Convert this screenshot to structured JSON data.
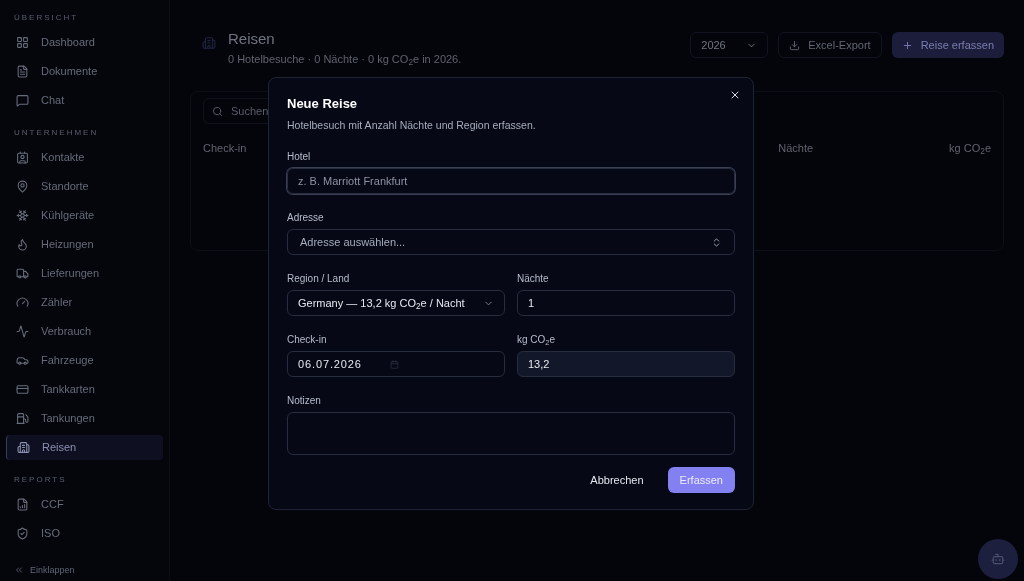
{
  "sidebar": {
    "sections": [
      {
        "title": "ÜBERSICHT",
        "items": [
          {
            "label": "Dashboard",
            "selected": false
          },
          {
            "label": "Dokumente",
            "selected": false
          },
          {
            "label": "Chat",
            "selected": false
          }
        ]
      },
      {
        "title": "UNTERNEHMEN",
        "items": [
          {
            "label": "Kontakte",
            "selected": false
          },
          {
            "label": "Standorte",
            "selected": false
          },
          {
            "label": "Kühlgeräte",
            "selected": false
          },
          {
            "label": "Heizungen",
            "selected": false
          },
          {
            "label": "Lieferungen",
            "selected": false
          },
          {
            "label": "Zähler",
            "selected": false
          },
          {
            "label": "Verbrauch",
            "selected": false
          },
          {
            "label": "Fahrzeuge",
            "selected": false
          },
          {
            "label": "Tankkarten",
            "selected": false
          },
          {
            "label": "Tankungen",
            "selected": false
          },
          {
            "label": "Reisen",
            "selected": true
          }
        ]
      },
      {
        "title": "REPORTS",
        "items": [
          {
            "label": "CCF",
            "selected": false
          },
          {
            "label": "ISO",
            "selected": false
          }
        ]
      }
    ],
    "collapse": "Einklappen"
  },
  "page": {
    "title": "Reisen",
    "subtitle": "0 Hotelbesuche · 0 Nächte · 0 kg CO$_{2}$e in 2026.",
    "year": "2026",
    "export": "Excel-Export",
    "add": "Reise erfassen",
    "search": {
      "placeholder": "Suchen"
    },
    "table": {
      "columns": [
        "Check-in",
        "Nächte",
        "kg CO$_{2}$e"
      ]
    }
  },
  "dialog": {
    "title": "Neue Reise",
    "description": "Hotelbesuch mit Anzahl Nächte und Region erfassen.",
    "hotel": {
      "label": "Hotel",
      "placeholder": "z. B. Marriott Frankfurt",
      "focused": true
    },
    "address": {
      "label": "Adresse",
      "placeholder": "Adresse auswählen..."
    },
    "region": {
      "label": "Region / Land",
      "value": "Germany — 13,2 kg CO$_{2}$e / Nacht"
    },
    "nights": {
      "label": "Nächte",
      "value": "1"
    },
    "checkin": {
      "label": "Check-in",
      "value": "06.07.2026"
    },
    "co2": {
      "label": "kg CO$_{2}$e",
      "value": "13,2",
      "readonly": true
    },
    "notes": {
      "label": "Notizen"
    },
    "cancel": "Abbrechen",
    "submit": "Erfassen"
  }
}
